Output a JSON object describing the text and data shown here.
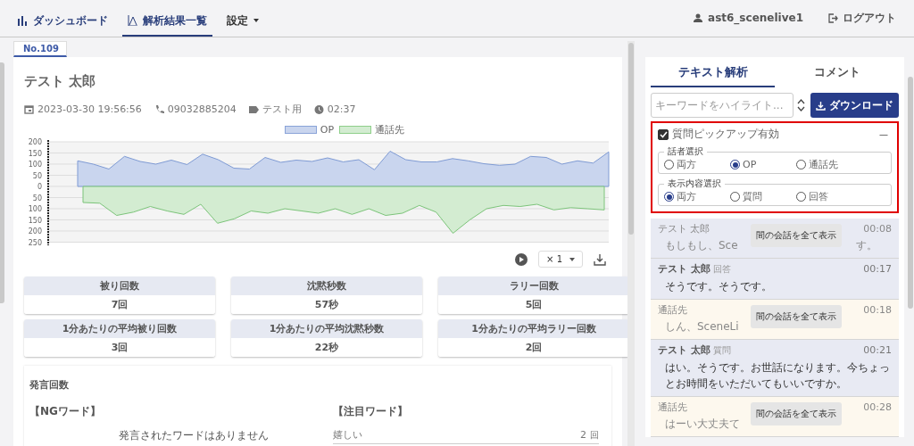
{
  "nav": {
    "items": [
      {
        "label": "ダッシュボード",
        "selected": false,
        "dropdown": false
      },
      {
        "label": "解析結果一覧",
        "selected": true,
        "dropdown": false
      },
      {
        "label": "設定",
        "selected": false,
        "dropdown": true
      }
    ],
    "user": "ast6_scenelive1",
    "logout": "ログアウト"
  },
  "record_tab": "No.109",
  "record": {
    "name": "テスト 太郎",
    "datetime": "2023-03-30 19:56:56",
    "phone": "09032885204",
    "tag": "テスト用",
    "duration": "02:37"
  },
  "waveform": {
    "legend": [
      {
        "label": "OP",
        "color": "#c9d5ee"
      },
      {
        "label": "通話先",
        "color": "#d3ecd1"
      }
    ],
    "y_axis_labels": [
      "200",
      "150",
      "100",
      "50",
      "0",
      "50",
      "100",
      "150",
      "200",
      "250"
    ],
    "speed": "× 1"
  },
  "stats": [
    {
      "label": "被り回数",
      "value": "7回"
    },
    {
      "label": "沈黙秒数",
      "value": "57秒"
    },
    {
      "label": "ラリー回数",
      "value": "5回"
    },
    {
      "label": "1分あたりの平均被り回数",
      "value": "3回"
    },
    {
      "label": "1分あたりの平均沈黙秒数",
      "value": "22秒"
    },
    {
      "label": "1分あたりの平均ラリー回数",
      "value": "2回"
    }
  ],
  "speech_count": {
    "title": "発言回数",
    "ng_title": "【NGワード】",
    "ng_empty": "発言されたワードはありません",
    "focus_title": "【注目ワード】",
    "focus_words": [
      {
        "word": "嬉しい",
        "count": "2",
        "unit": "回"
      }
    ]
  },
  "panel": {
    "tabs": [
      {
        "label": "テキスト解析",
        "selected": true
      },
      {
        "label": "コメント",
        "selected": false
      }
    ],
    "search": {
      "placeholder": "キーワードをハイライト..."
    },
    "download": "ダウンロード",
    "pickup": {
      "label": "質問ピックアップ有効",
      "checked": true,
      "collapse": "—",
      "groups": [
        {
          "legend": "話者選択",
          "options": [
            {
              "label": "両方",
              "selected": false
            },
            {
              "label": "OP",
              "selected": true
            },
            {
              "label": "通話先",
              "selected": false
            }
          ]
        },
        {
          "legend": "表示内容選択",
          "options": [
            {
              "label": "両方",
              "selected": true
            },
            {
              "label": "質問",
              "selected": false
            },
            {
              "label": "回答",
              "selected": false
            }
          ]
        }
      ]
    },
    "messages": [
      {
        "speaker": "テスト 太郎",
        "kind": "op",
        "dimmed": true,
        "time": "00:08",
        "text_parts": [
          "もしもし、Sce",
          "す。"
        ],
        "overlay": "間の会話を全て表示"
      },
      {
        "speaker": "テスト 太郎",
        "kind": "op",
        "dimmed": false,
        "tag": "回答",
        "time": "00:17",
        "text": "そうです。そうです。"
      },
      {
        "speaker": "通話先",
        "kind": "callee",
        "dimmed": true,
        "time": "00:18",
        "text_parts": [
          "しん、SceneLi"
        ],
        "overlay": "間の会話を全て表示"
      },
      {
        "speaker": "テスト 太郎",
        "kind": "op",
        "dimmed": false,
        "tag": "質問",
        "time": "00:21",
        "text": "はい。そうです。お世話になります。今ちょっとお時間をいただいてもいいですか。"
      },
      {
        "speaker": "通話先",
        "kind": "callee",
        "dimmed": true,
        "time": "00:28",
        "text_parts": [
          "はーい大丈夫て"
        ],
        "overlay": "間の会話を全て表示"
      }
    ]
  }
}
